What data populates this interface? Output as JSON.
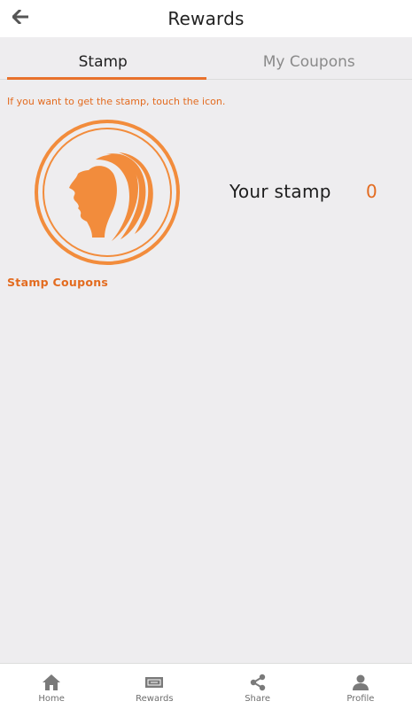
{
  "header": {
    "title": "Rewards",
    "back_icon": "arrow-left-icon"
  },
  "tabs": [
    {
      "label": "Stamp",
      "active": true
    },
    {
      "label": "My Coupons",
      "active": false
    }
  ],
  "hint": "If you want to get the stamp, touch the icon.",
  "stamp": {
    "icon": "woman-profile-hair-icon",
    "caption": "Stamp Coupons",
    "label": "Your stamp",
    "count": "0"
  },
  "bottom_nav": [
    {
      "label": "Home",
      "icon": "home-icon"
    },
    {
      "label": "Rewards",
      "icon": "ticket-icon"
    },
    {
      "label": "Share",
      "icon": "share-icon"
    },
    {
      "label": "Profile",
      "icon": "user-icon"
    }
  ],
  "colors": {
    "accent": "#e8722c",
    "background": "#eeedef",
    "icon_gray": "#7a7a7a"
  }
}
